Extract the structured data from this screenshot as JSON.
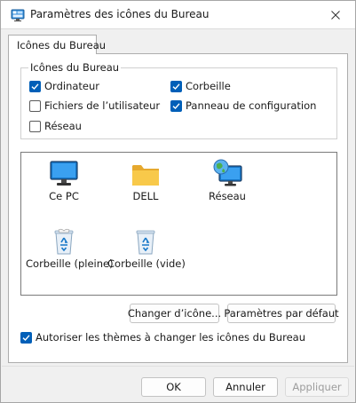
{
  "window": {
    "title": "Paramètres des icônes du Bureau"
  },
  "tab": {
    "label": "Icônes du Bureau"
  },
  "group": {
    "legend": "Icônes du Bureau",
    "checkboxes": [
      {
        "label": "Ordinateur",
        "checked": true
      },
      {
        "label": "Corbeille",
        "checked": true
      },
      {
        "label": "Fichiers de l’utilisateur",
        "checked": false
      },
      {
        "label": "Panneau de configuration",
        "checked": true
      },
      {
        "label": "Réseau",
        "checked": false
      }
    ]
  },
  "icons": [
    {
      "label": "Ce PC",
      "icon": "monitor-icon"
    },
    {
      "label": "DELL",
      "icon": "folder-icon"
    },
    {
      "label": "Réseau",
      "icon": "network-globe-icon"
    },
    {
      "label": "Corbeille (pleine)",
      "icon": "recycle-bin-full-icon"
    },
    {
      "label": "Corbeille (vide)",
      "icon": "recycle-bin-empty-icon"
    }
  ],
  "buttons": {
    "change_icon": "Changer d’icône...",
    "defaults": "Paramètres par défaut",
    "ok": "OK",
    "cancel": "Annuler",
    "apply": "Appliquer"
  },
  "themes_checkbox": {
    "label": "Autoriser les thèmes à changer les icônes du Bureau",
    "checked": true
  },
  "colors": {
    "accent": "#005fb8",
    "folder": "#f8c94a",
    "monitor": "#1677c8"
  }
}
